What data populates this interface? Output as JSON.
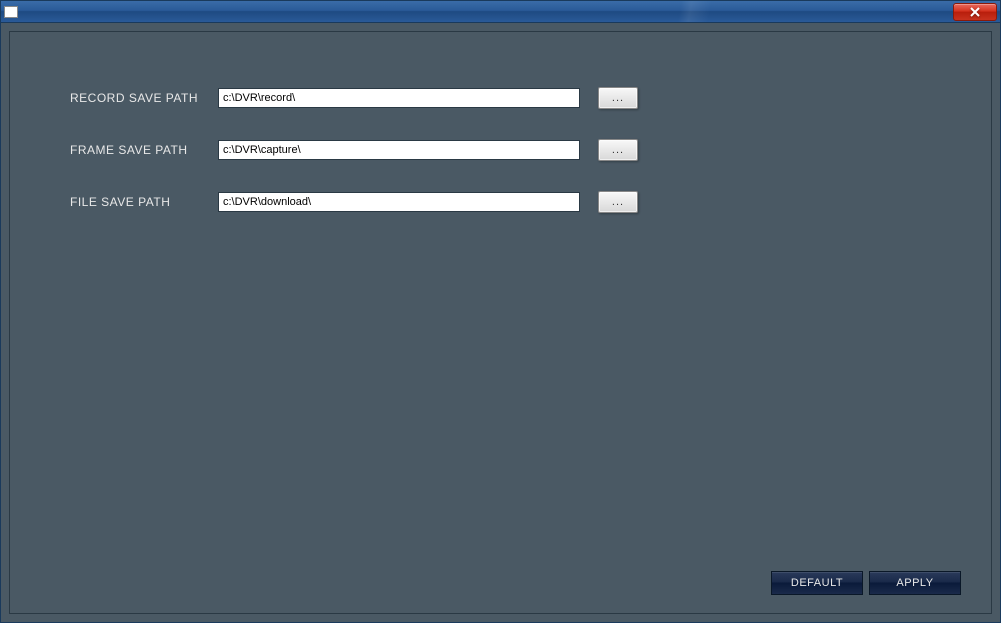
{
  "paths": {
    "record": {
      "label": "RECORD SAVE PATH",
      "value": "c:\\DVR\\record\\"
    },
    "frame": {
      "label": "FRAME SAVE PATH",
      "value": "c:\\DVR\\capture\\"
    },
    "file": {
      "label": "FILE SAVE PATH",
      "value": "c:\\DVR\\download\\"
    }
  },
  "browse_label": "...",
  "buttons": {
    "default": "DEFAULT",
    "apply": "APPLY"
  }
}
